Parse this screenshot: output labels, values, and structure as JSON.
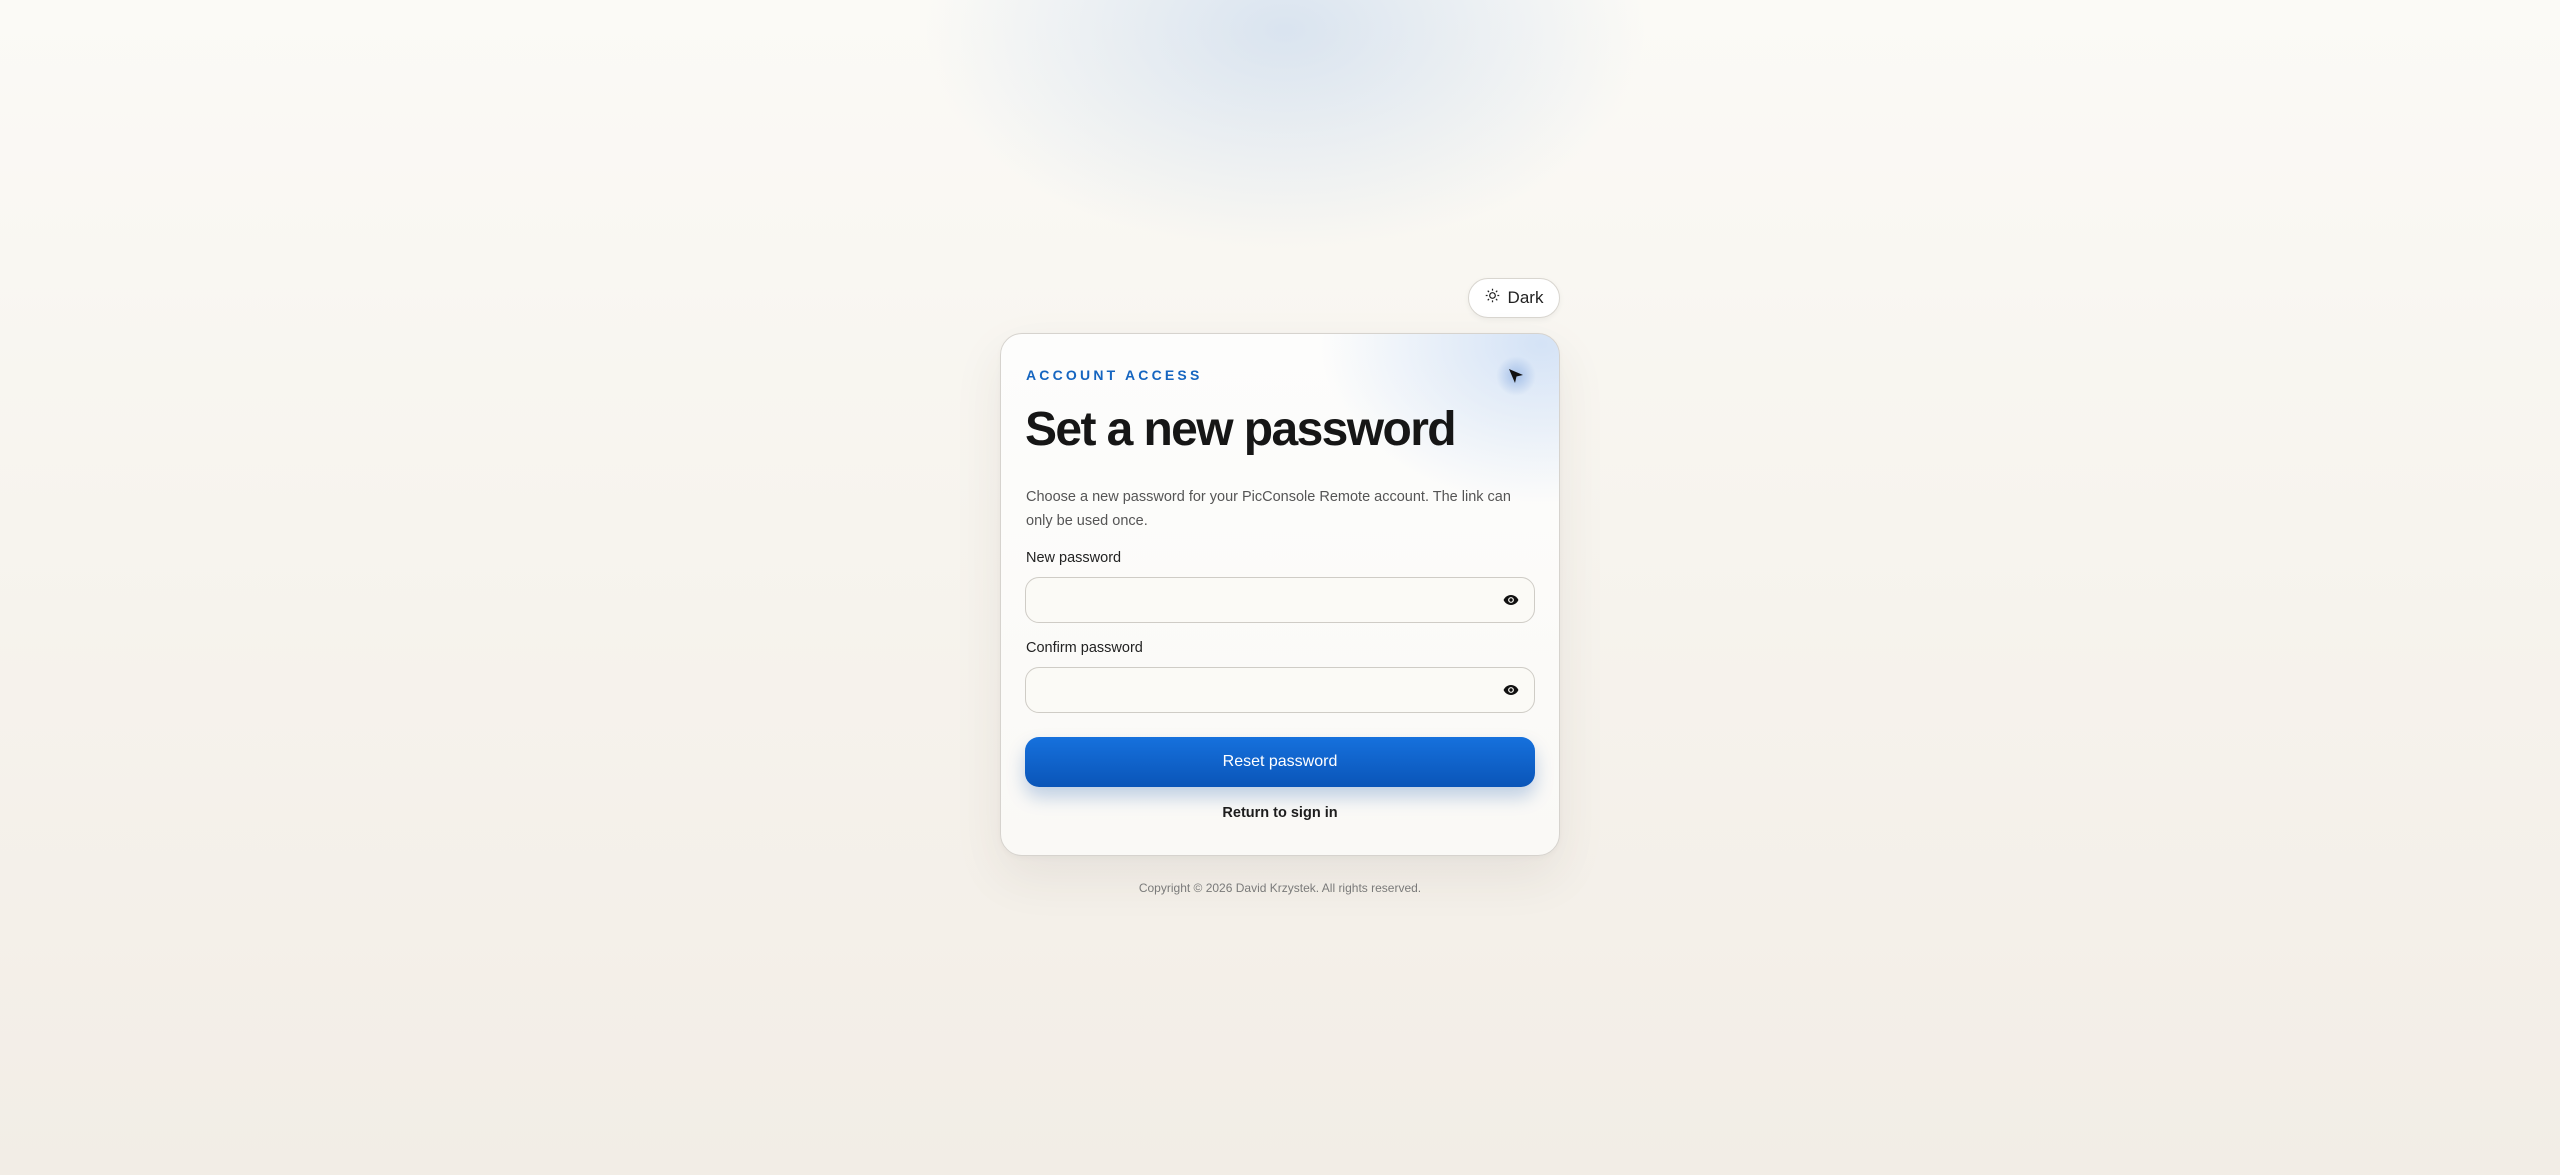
{
  "theme_toggle": {
    "label": "Dark",
    "icon": "sun-icon"
  },
  "card": {
    "eyebrow": "ACCOUNT ACCESS",
    "title": "Set a new password",
    "description": "Choose a new password for your PicConsole Remote account. The link can only be used once.",
    "cursor_icon": "cursor-arrow-icon"
  },
  "form": {
    "new_password": {
      "label": "New password",
      "value": "",
      "visibility_icon": "eye-icon"
    },
    "confirm_password": {
      "label": "Confirm password",
      "value": "",
      "visibility_icon": "eye-icon"
    },
    "submit_label": "Reset password",
    "return_link": "Return to sign in"
  },
  "footer": {
    "copyright": "Copyright © 2026 David Krzystek. All rights reserved."
  },
  "colors": {
    "accent": "#1565c0",
    "button_top": "#1671dd",
    "button_bottom": "#0a55b8",
    "background": "#f7f4ee"
  }
}
